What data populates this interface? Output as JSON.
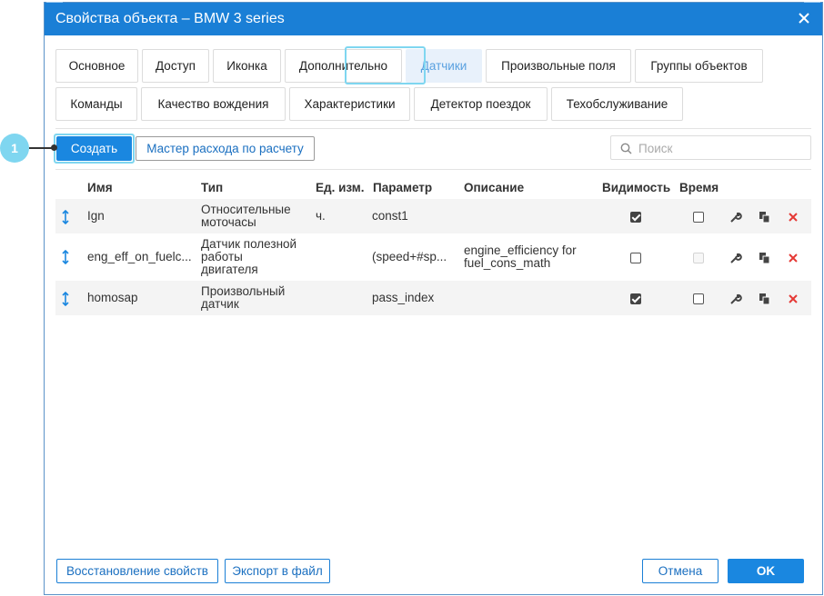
{
  "dialog": {
    "title": "Свойства объекта – BMW 3 series",
    "close_icon": "close-icon"
  },
  "tabs": [
    {
      "label": "Основное"
    },
    {
      "label": "Доступ"
    },
    {
      "label": "Иконка"
    },
    {
      "label": "Дополнительно"
    },
    {
      "label": "Датчики",
      "active": true
    },
    {
      "label": "Произвольные поля"
    },
    {
      "label": "Группы объектов"
    },
    {
      "label": "Команды"
    },
    {
      "label": "Качество вождения"
    },
    {
      "label": "Характеристики"
    },
    {
      "label": "Детектор поездок"
    },
    {
      "label": "Техобслуживание"
    }
  ],
  "toolbar": {
    "create_label": "Создать",
    "wizard_label": "Мастер расхода по расчету",
    "search_placeholder": "Поиск"
  },
  "table": {
    "headers": {
      "name": "Имя",
      "type": "Тип",
      "unit": "Ед. изм.",
      "param": "Параметр",
      "desc": "Описание",
      "visibility": "Видимость",
      "time": "Время"
    },
    "rows": [
      {
        "name": "Ign",
        "type_l1": "Относительные",
        "type_l2": "моточасы",
        "type_l3": "",
        "unit": "ч.",
        "param": "const1",
        "desc_l1": "",
        "desc_l2": "",
        "visibility": true,
        "time": false,
        "time_disabled": false
      },
      {
        "name": "eng_eff_on_fuelc...",
        "type_l1": "Датчик полезной",
        "type_l2": "работы",
        "type_l3": "двигателя",
        "unit": "",
        "param": "(speed+#sp...",
        "desc_l1": "engine_efficiency for",
        "desc_l2": "fuel_cons_math",
        "visibility": false,
        "time": false,
        "time_disabled": true
      },
      {
        "name": "homosap",
        "type_l1": "Произвольный",
        "type_l2": "датчик",
        "type_l3": "",
        "unit": "",
        "param": "pass_index",
        "desc_l1": "",
        "desc_l2": "",
        "visibility": true,
        "time": false,
        "time_disabled": false
      }
    ]
  },
  "footer": {
    "restore_label": "Восстановление свойств",
    "export_label": "Экспорт в файл",
    "cancel_label": "Отмена",
    "ok_label": "OK"
  },
  "callout": {
    "number": "1"
  },
  "colors": {
    "accent": "#1a87e0",
    "titlebar": "#1a7fd6",
    "highlight": "#7fd6f0",
    "delete": "#e53935"
  }
}
